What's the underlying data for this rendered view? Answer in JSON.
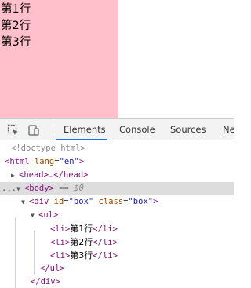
{
  "page": {
    "lines": [
      "第1行",
      "第2行",
      "第3行"
    ]
  },
  "devtools": {
    "tabs": [
      "Elements",
      "Console",
      "Sources",
      "Ne"
    ],
    "active_tab": "Elements",
    "accent_color": "#1a73e8",
    "toolbar_icons": [
      "inspect-element-icon",
      "device-toolbar-icon"
    ]
  },
  "dom": {
    "doctype": "<!doctype html>",
    "html_open": "<html",
    "html_lang_attr": "lang",
    "html_lang_val": "\"en\"",
    "html_close_bracket": ">",
    "head": "<head>…</head>",
    "body_open": "<body>",
    "body_suffix": "== $0",
    "row_prefix": "...",
    "div_open": "<div",
    "div_id_attr": "id",
    "div_id_val": "\"box\"",
    "div_class_attr": "class",
    "div_class_val": "\"box\"",
    "ul_open": "<ul>",
    "li_open": "<li>",
    "li_close": "</li>",
    "li_items": [
      "第1行",
      "第2行",
      "第3行"
    ],
    "ul_close": "</ul>",
    "div_close": "</div>"
  },
  "colors": {
    "box_background": "#ffc0cb",
    "tag": "#881280",
    "attr_name": "#994500",
    "attr_value": "#1a1aa6"
  }
}
